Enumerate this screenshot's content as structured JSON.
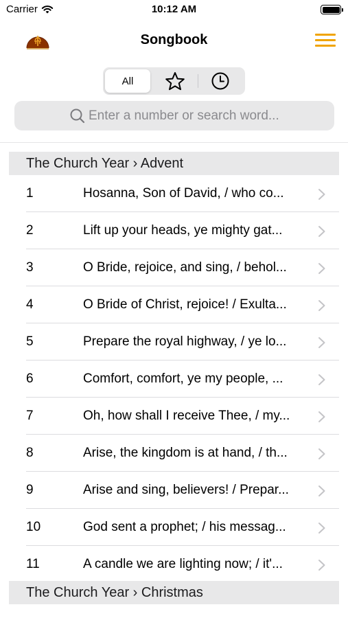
{
  "status_bar": {
    "carrier": "Carrier",
    "time": "10:12 AM"
  },
  "nav": {
    "title": "Songbook"
  },
  "segments": {
    "all_label": "All"
  },
  "search": {
    "placeholder": "Enter a number or search word..."
  },
  "sections": [
    {
      "title": "The Church Year › Advent",
      "songs": [
        {
          "number": "1",
          "title": "Hosanna, Son of David, / who co..."
        },
        {
          "number": "2",
          "title": "Lift up your heads, ye mighty gat..."
        },
        {
          "number": "3",
          "title": "O Bride, rejoice, and sing, / behol..."
        },
        {
          "number": "4",
          "title": "O Bride of Christ, rejoice! / Exulta..."
        },
        {
          "number": "5",
          "title": "Prepare the royal highway, / ye lo..."
        },
        {
          "number": "6",
          "title": "Comfort, comfort, ye my people, ..."
        },
        {
          "number": "7",
          "title": "Oh, how shall I receive Thee, / my..."
        },
        {
          "number": "8",
          "title": "Arise, the kingdom is at hand, / th..."
        },
        {
          "number": "9",
          "title": "Arise and sing, believers! / Prepar..."
        },
        {
          "number": "10",
          "title": "God sent a prophet; / his messag..."
        },
        {
          "number": "11",
          "title": "A candle we are lighting now; / it'..."
        }
      ]
    },
    {
      "title": "The Church Year › Christmas",
      "songs": []
    }
  ],
  "colors": {
    "accent": "#f0a400",
    "section_bg": "#e8e8e9",
    "chevron": "#c4c4c7"
  }
}
